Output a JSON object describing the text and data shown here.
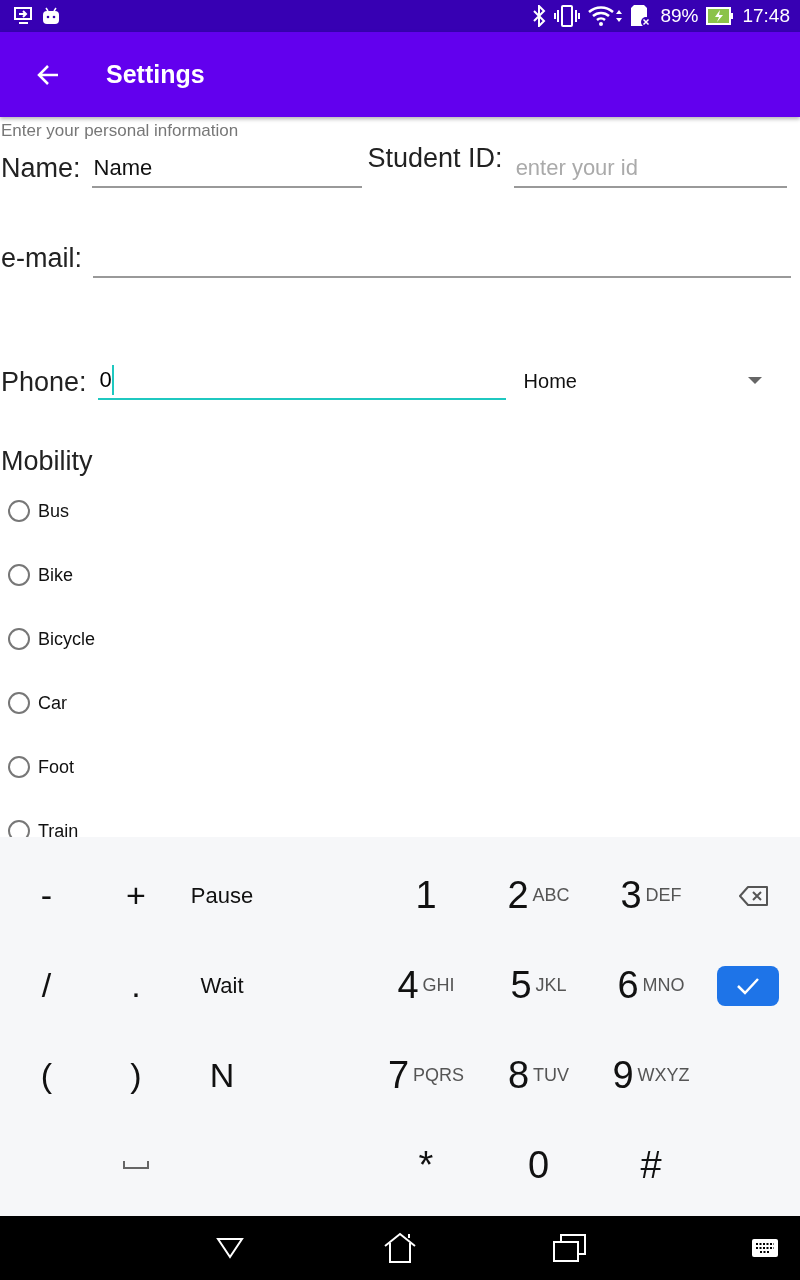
{
  "status_bar": {
    "battery": "89%",
    "time": "17:48"
  },
  "app_bar": {
    "title": "Settings"
  },
  "form": {
    "hint": "Enter your personal information",
    "name": {
      "label": "Name:",
      "value": "Name",
      "focused": false
    },
    "student_id": {
      "label": "Student ID:",
      "placeholder": "enter your id",
      "focused": false
    },
    "email": {
      "label": "e-mail:",
      "focused": false
    },
    "phone": {
      "label": "Phone:",
      "value": "0",
      "focused": true
    },
    "phone_type": {
      "value": "Home"
    },
    "mobility": {
      "title": "Mobility",
      "options": [
        {
          "label": "Bus",
          "selected": false
        },
        {
          "label": "Bike",
          "selected": false
        },
        {
          "label": "Bicycle",
          "selected": false
        },
        {
          "label": "Car",
          "selected": false
        },
        {
          "label": "Foot",
          "selected": false
        },
        {
          "label": "Train",
          "selected": false
        }
      ]
    }
  },
  "keyboard": {
    "rows": [
      {
        "left": [
          {
            "kind": "symbol",
            "label": "-"
          },
          {
            "kind": "symbol",
            "label": "+"
          },
          {
            "kind": "word",
            "label": "Pause"
          }
        ],
        "right": [
          {
            "kind": "digit",
            "label": "1"
          },
          {
            "kind": "digit",
            "label": "2",
            "letters": "ABC"
          },
          {
            "kind": "digit",
            "label": "3",
            "letters": "DEF"
          },
          {
            "kind": "backspace"
          }
        ]
      },
      {
        "left": [
          {
            "kind": "symbol",
            "label": "/"
          },
          {
            "kind": "symbol",
            "label": "."
          },
          {
            "kind": "word",
            "label": "Wait"
          }
        ],
        "right": [
          {
            "kind": "digit",
            "label": "4",
            "letters": "GHI"
          },
          {
            "kind": "digit",
            "label": "5",
            "letters": "JKL"
          },
          {
            "kind": "digit",
            "label": "6",
            "letters": "MNO"
          },
          {
            "kind": "done"
          }
        ]
      },
      {
        "left": [
          {
            "kind": "symbol",
            "label": "("
          },
          {
            "kind": "symbol",
            "label": ")"
          },
          {
            "kind": "symbol",
            "label": "N"
          }
        ],
        "right": [
          {
            "kind": "digit",
            "label": "7",
            "letters": "PQRS"
          },
          {
            "kind": "digit",
            "label": "8",
            "letters": "TUV"
          },
          {
            "kind": "digit",
            "label": "9",
            "letters": "WXYZ"
          },
          {
            "kind": "blank"
          }
        ]
      },
      {
        "left": [
          {
            "kind": "blank"
          },
          {
            "kind": "space"
          },
          {
            "kind": "blank"
          }
        ],
        "right": [
          {
            "kind": "digit",
            "label": "*"
          },
          {
            "kind": "digit",
            "label": "0"
          },
          {
            "kind": "digit",
            "label": "#"
          },
          {
            "kind": "blank"
          }
        ]
      }
    ]
  }
}
